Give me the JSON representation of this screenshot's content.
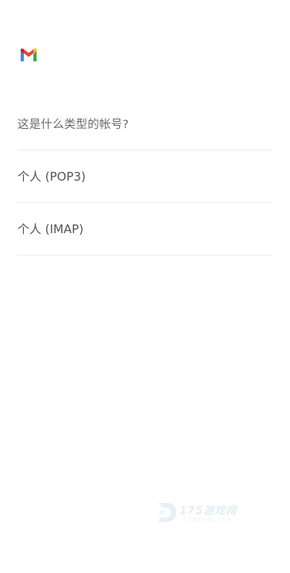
{
  "app": {
    "logo_icon": "gmail-logo-icon",
    "colors": {
      "red": "#EA4335",
      "blue": "#4285F4",
      "green": "#34A853",
      "yellow": "#FBBC04"
    }
  },
  "account_type": {
    "question": "这是什么类型的帐号?",
    "options": [
      {
        "label": "个人 (POP3)"
      },
      {
        "label": "个人 (IMAP)"
      }
    ]
  },
  "watermark": {
    "text": "175游戏网",
    "subtext": "175WAN.COM"
  }
}
